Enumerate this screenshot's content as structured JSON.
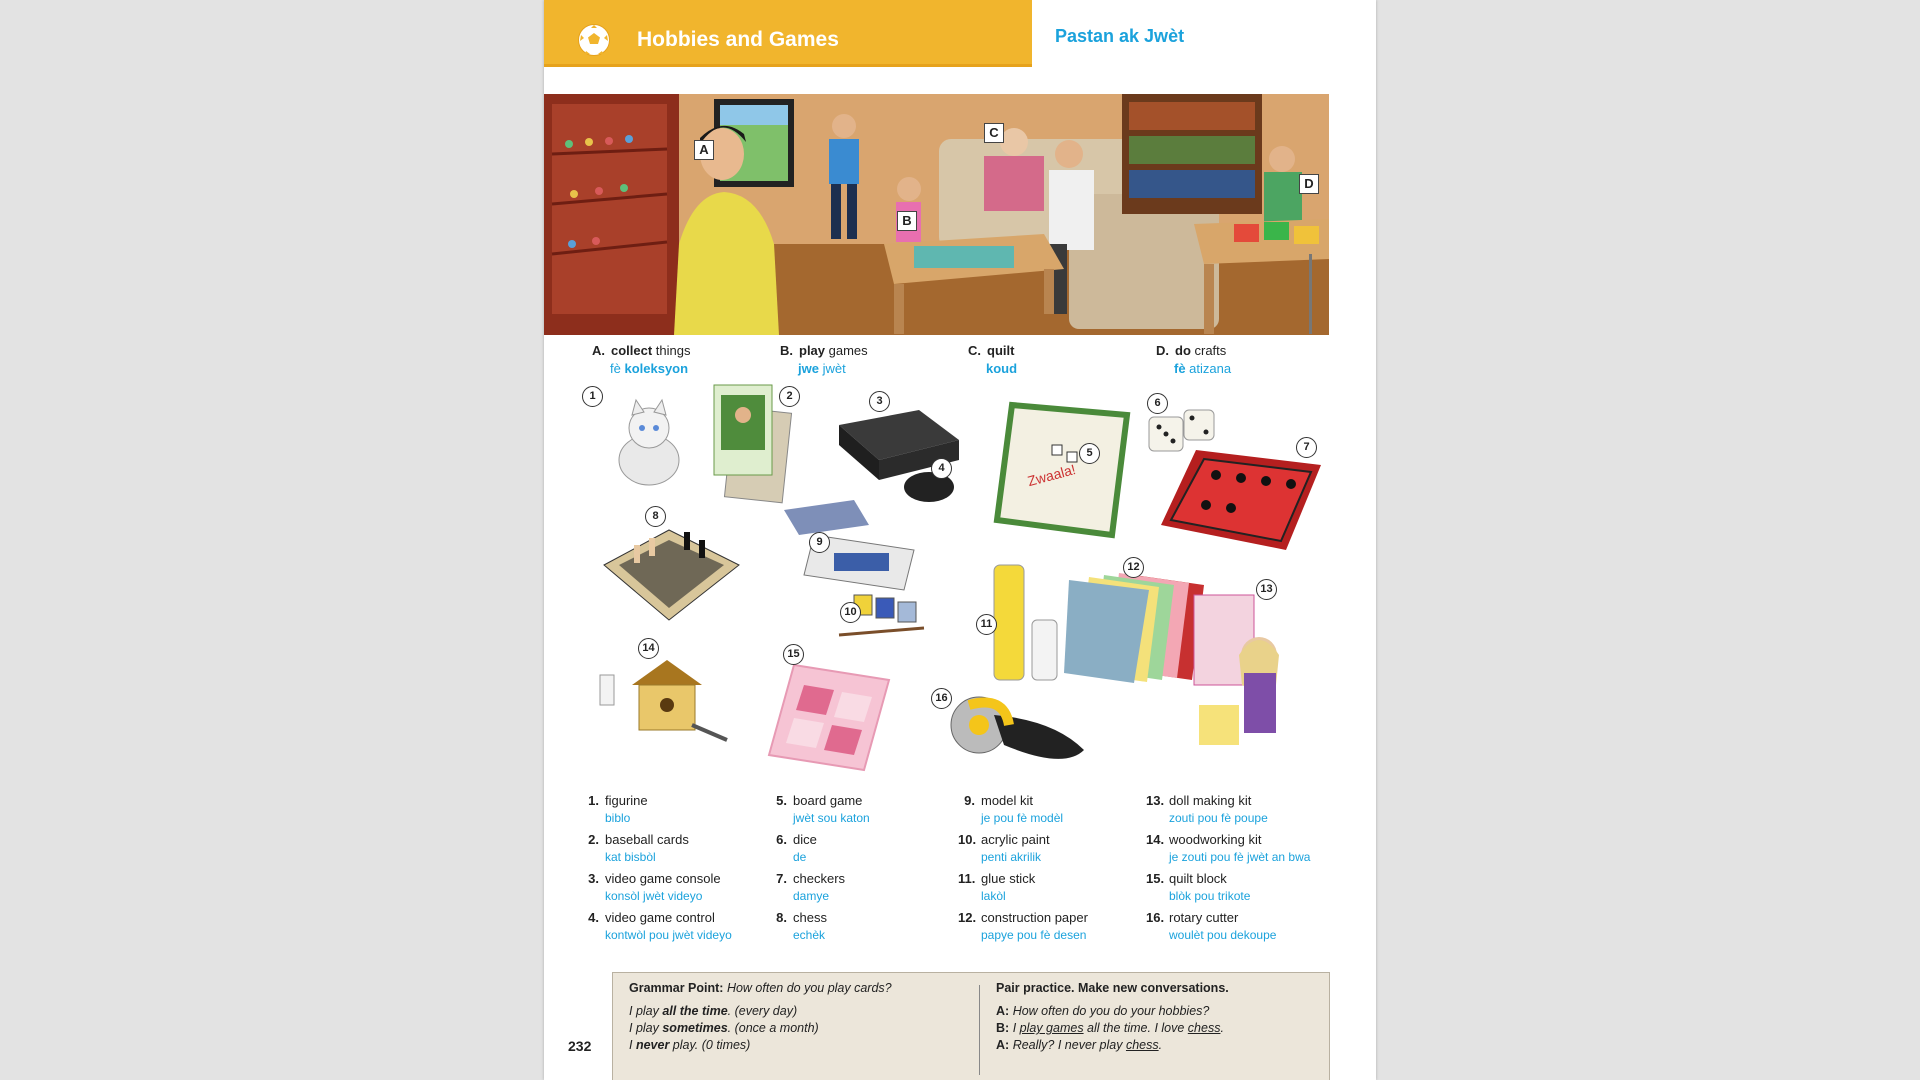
{
  "header": {
    "title": "Hobbies and Games",
    "subtitle": "Pastan ak Jwèt"
  },
  "scene_labels": [
    "A",
    "B",
    "C",
    "D"
  ],
  "actions": [
    {
      "letter": "A.",
      "verb": "collect",
      "rest": " things",
      "ht_pre": "fè ",
      "ht_bold": "koleksyon",
      "ht_rest": ""
    },
    {
      "letter": "B.",
      "verb": "play",
      "rest": " games",
      "ht_pre": "",
      "ht_bold": "jwe",
      "ht_rest": " jwèt"
    },
    {
      "letter": "C.",
      "verb": "quilt",
      "rest": "",
      "ht_pre": "",
      "ht_bold": "koud",
      "ht_rest": ""
    },
    {
      "letter": "D.",
      "verb": "do",
      "rest": " crafts",
      "ht_pre": "",
      "ht_bold": "fè",
      "ht_rest": " atizana"
    }
  ],
  "item_numbers": [
    "1",
    "2",
    "3",
    "4",
    "5",
    "6",
    "7",
    "8",
    "9",
    "10",
    "11",
    "12",
    "13",
    "14",
    "15",
    "16"
  ],
  "vocab": [
    {
      "n": "1.",
      "en": "figurine",
      "ht": "biblo"
    },
    {
      "n": "2.",
      "en": "baseball cards",
      "ht": "kat bisbòl"
    },
    {
      "n": "3.",
      "en": "video game console",
      "ht": "konsòl jwèt videyo"
    },
    {
      "n": "4.",
      "en": "video game control",
      "ht": "kontwòl pou jwèt videyo"
    },
    {
      "n": "5.",
      "en": "board game",
      "ht": "jwèt sou katon"
    },
    {
      "n": "6.",
      "en": "dice",
      "ht": "de"
    },
    {
      "n": "7.",
      "en": "checkers",
      "ht": "damye"
    },
    {
      "n": "8.",
      "en": "chess",
      "ht": "echèk"
    },
    {
      "n": "9.",
      "en": "model kit",
      "ht": "je pou fè modèl"
    },
    {
      "n": "10.",
      "en": "acrylic paint",
      "ht": "penti akrilik"
    },
    {
      "n": "11.",
      "en": "glue stick",
      "ht": "lakòl"
    },
    {
      "n": "12.",
      "en": "construction paper",
      "ht": "papye pou fè desen"
    },
    {
      "n": "13.",
      "en": "doll making kit",
      "ht": "zouti pou fè poupe"
    },
    {
      "n": "14.",
      "en": "woodworking kit",
      "ht": "je zouti pou fè jwèt an bwa"
    },
    {
      "n": "15.",
      "en": "quilt block",
      "ht": "blòk pou trikote"
    },
    {
      "n": "16.",
      "en": "rotary cutter",
      "ht": "woulèt pou dekoupe"
    }
  ],
  "grammar": {
    "heading_bold": "Grammar Point:",
    "heading_italic": " How often do you play cards?",
    "lines": [
      {
        "pre": "I play ",
        "bold": "all the time",
        "post": ". (every day)"
      },
      {
        "pre": "I play ",
        "bold": "sometimes",
        "post": ". (once a month)"
      },
      {
        "pre": "I ",
        "bold": "never",
        "post": " play. (0 times)"
      }
    ]
  },
  "practice": {
    "heading": "Pair practice. Make new conversations.",
    "line_a1_label": "A:",
    "line_a1": "How often do you do your hobbies?",
    "line_b_label": "B:",
    "line_b_pre": "I ",
    "line_b_u1": "play games",
    "line_b_mid": " all the time. I love ",
    "line_b_u2": "chess",
    "line_b_end": ".",
    "line_a2_label": "A:",
    "line_a2_pre": "Really? I never play ",
    "line_a2_u": "chess",
    "line_a2_end": "."
  },
  "page_number": "232",
  "colors": {
    "header_bar": "#f1b52d",
    "translation_blue": "#1ba2dc",
    "grammar_bg": "#ece6da"
  }
}
